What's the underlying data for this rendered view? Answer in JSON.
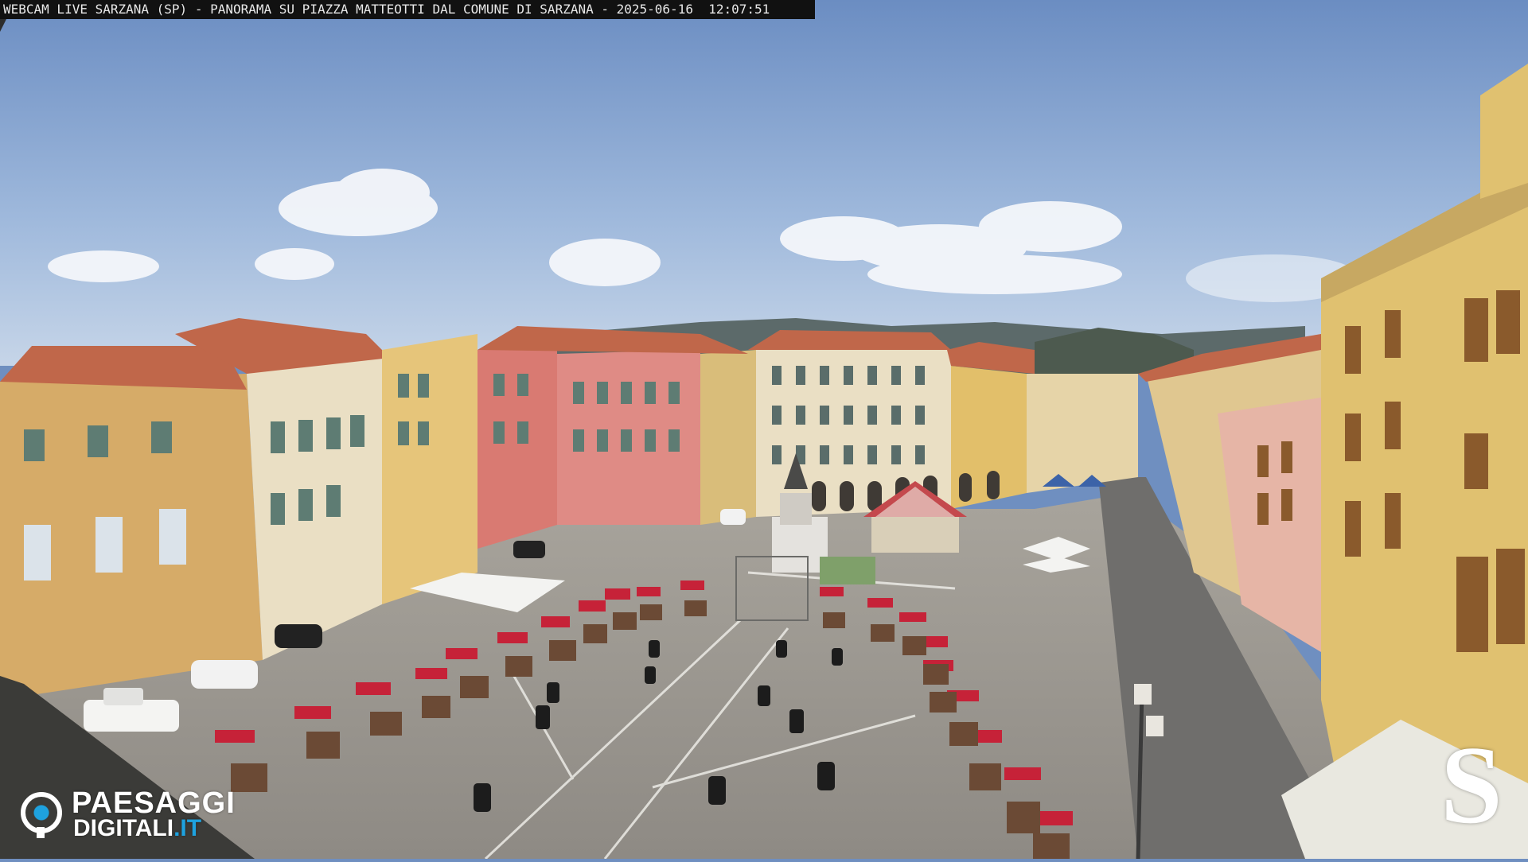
{
  "overlay": {
    "caption_parts": [
      "WEBCAM LIVE SARZANA (SP) - PANORAMA SU PIAZZA MATTEOTTI DAL COMUNE DI SARZANA - ",
      "2025-06-16",
      "  12:07:51"
    ],
    "logo_word1": "PAESAGGI",
    "logo_word2": "DIGITALI",
    "logo_suffix": ".IT",
    "corner_logo": "S"
  },
  "colors": {
    "sky_top": "#6d8fc2",
    "sky_bottom": "#b9cbe2",
    "pavement": "#9a9690",
    "facade_ochre": "#d6ab68",
    "facade_pink": "#d97a72",
    "facade_cream": "#eadfc4",
    "roof_terracotta": "#c0674a",
    "stall_red": "#c62238",
    "logo_blue": "#1ea2df"
  }
}
